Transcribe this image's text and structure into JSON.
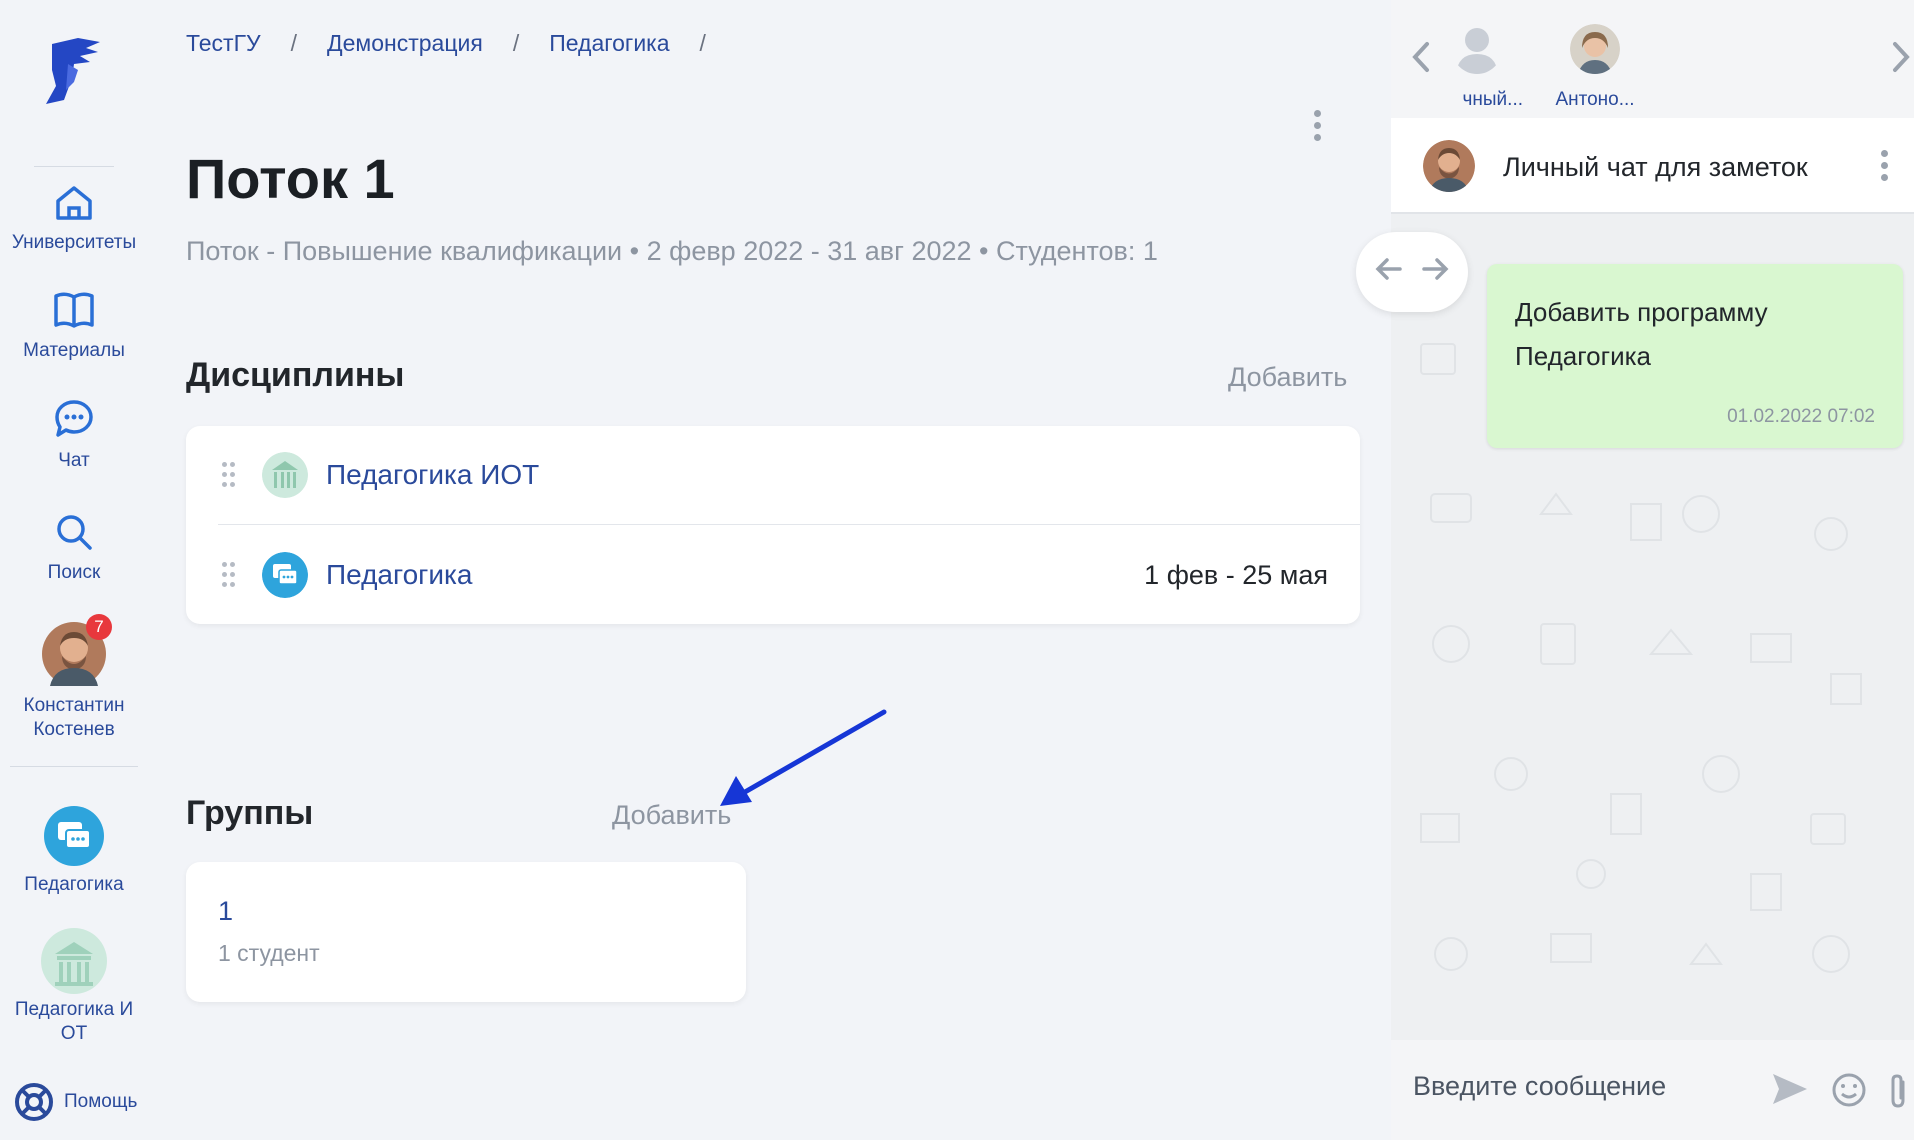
{
  "breadcrumb": [
    "ТестГУ",
    "Демонстрация",
    "Педагогика"
  ],
  "breadcrumb_sep": "/",
  "sidebar": {
    "items": [
      {
        "label": "Университеты",
        "icon": "home-icon"
      },
      {
        "label": "Материалы",
        "icon": "book-icon"
      },
      {
        "label": "Чат",
        "icon": "chat-icon"
      },
      {
        "label": "Поиск",
        "icon": "search-icon"
      }
    ],
    "user": {
      "name_line1": "Константин",
      "name_line2": "Костенев",
      "badge": "7"
    },
    "courses": [
      {
        "label": "Педагогика",
        "icon": "course-chat-icon"
      },
      {
        "label_line1": "Педагогика И",
        "label_line2": "ОТ",
        "icon": "building-icon"
      }
    ],
    "help_label": "Помощь"
  },
  "page": {
    "title": "Поток 1",
    "meta": "Поток - Повышение квалификации • 2 февр 2022 - 31 авг 2022 • Студентов: 1"
  },
  "disciplines": {
    "title": "Дисциплины",
    "add_label": "Добавить",
    "items": [
      {
        "name": "Педагогика ИОТ",
        "dates": ""
      },
      {
        "name": "Педагогика",
        "dates": "1 фев - 25 мая"
      }
    ]
  },
  "groups": {
    "title": "Группы",
    "add_label": "Добавить",
    "items": [
      {
        "number": "1",
        "count": "1 студент"
      }
    ]
  },
  "chat": {
    "contacts": [
      {
        "name": "чный..."
      },
      {
        "name": "Антоно..."
      }
    ],
    "header_title": "Личный чат для заметок",
    "message": {
      "text": "Добавить программу Педагогика",
      "time": "01.02.2022 07:02"
    },
    "input_placeholder": "Введите сообщение"
  },
  "colors": {
    "accent": "#2a4a9b",
    "badge": "#e8383d",
    "bubble": "#d9f7d0",
    "arrow": "#1636d6"
  }
}
